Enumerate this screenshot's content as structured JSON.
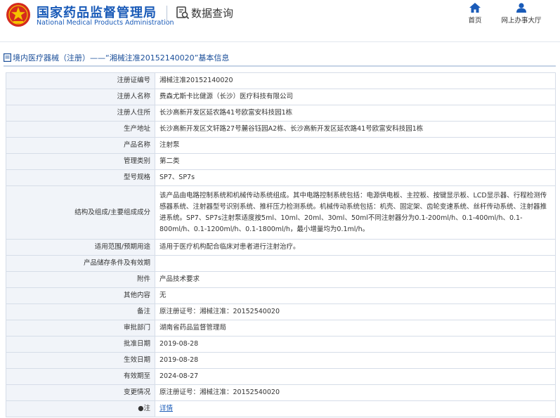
{
  "header": {
    "logo_cn": "国家药品监督管理局",
    "logo_en": "National Medical Products Administration",
    "logo_icon": "nmpa-emblem-icon",
    "query_icon": "data-query-icon",
    "query_title": "数据查询",
    "nav": [
      {
        "label": "首页",
        "icon": "home-icon"
      },
      {
        "label": "网上办事大厅",
        "icon": "user-icon"
      }
    ]
  },
  "breadcrumb": {
    "icon": "document-icon",
    "text": "境内医疗器械（注册）——“湘械注准20152140020”基本信息"
  },
  "colors": {
    "brand_blue": "#1a5bb8",
    "label_bg": "#f1f4f9",
    "border": "#d6dde8",
    "logo_red": "#d52b1e"
  },
  "rows": [
    {
      "label": "注册证编号",
      "value": "湘械注准20152140020"
    },
    {
      "label": "注册人名称",
      "value": "费森尤斯卡比健源（长沙）医疗科技有限公司"
    },
    {
      "label": "注册人住所",
      "value": "长沙高新开发区延农路41号欧富安科技园1栋"
    },
    {
      "label": "生产地址",
      "value": "长沙高新开发区文轩路27号麓谷钰园A2栋、长沙高新开发区延农路41号欧富安科技园1栋"
    },
    {
      "label": "产品名称",
      "value": "注射泵"
    },
    {
      "label": "管理类别",
      "value": "第二类"
    },
    {
      "label": "型号规格",
      "value": "SP7、SP7s"
    },
    {
      "label": "结构及组成/主要组成成分",
      "value": "该产品由电路控制系统和机械传动系统组成。其中电路控制系统包括：电源供电板、主控板、按键显示板、LCD显示器、行程检测传感器系统、注射器型号识别系统、推杆压力检测系统。机械传动系统包括：机壳、固定架、齿轮变速系统、丝杆传动系统、注射器推进系统。SP7、SP7s注射泵适度按5ml、10ml、20ml、30ml、50ml不同注射器分为0.1-200ml/h、0.1-400ml/h、0.1-800ml/h、0.1-1200ml/h、0.1-1800ml/h，最小增量均为0.1ml/h。"
    },
    {
      "label": "适用范围/预期用途",
      "value": "适用于医疗机构配合临床对患者进行注射治疗。"
    },
    {
      "label": "产品储存条件及有效期",
      "value": ""
    },
    {
      "label": "附件",
      "value": "产品技术要求"
    },
    {
      "label": "其他内容",
      "value": "无"
    },
    {
      "label": "备注",
      "value": "原注册证号：湘械注准：20152540020"
    },
    {
      "label": "审批部门",
      "value": "湖南省药品监督管理局"
    },
    {
      "label": "批准日期",
      "value": "2019-08-28"
    },
    {
      "label": "生效日期",
      "value": "2019-08-28"
    },
    {
      "label": "有效期至",
      "value": "2024-08-27"
    },
    {
      "label": "变更情况",
      "value": "原注册证号：湘械注准：20152540020"
    },
    {
      "label": "●注",
      "value": "详情"
    }
  ]
}
